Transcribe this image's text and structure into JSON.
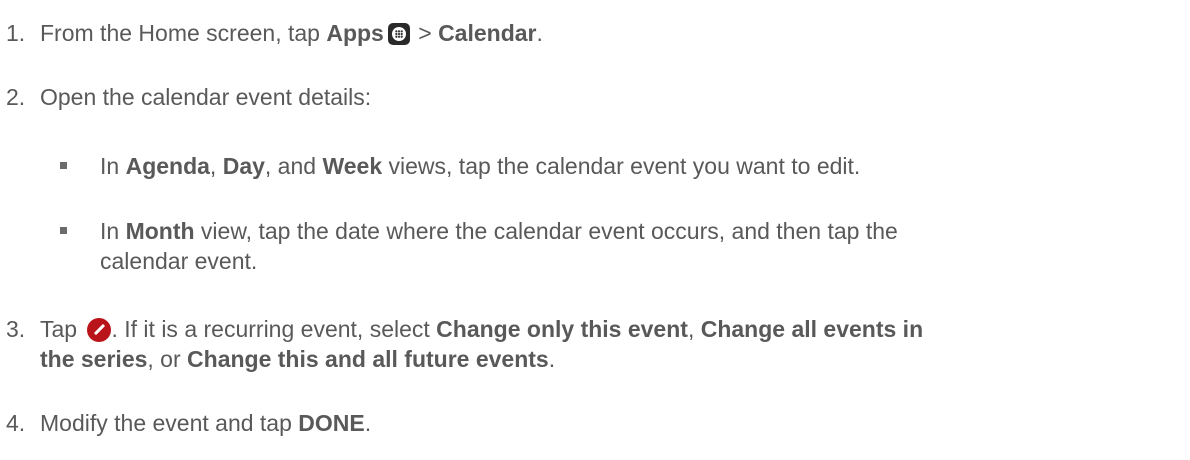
{
  "steps": [
    {
      "num": "1.",
      "t1": "From the Home screen, tap ",
      "b1": "Apps",
      "t2": " > ",
      "b2": "Calendar",
      "t3": "."
    },
    {
      "num": "2.",
      "t1": "Open the calendar event details:",
      "subs": [
        {
          "t1": "In ",
          "b1": "Agenda",
          "t2": ", ",
          "b2": "Day",
          "t3": ", and ",
          "b3": "Week",
          "t4": " views, tap the calendar event you want to edit."
        },
        {
          "t1": "In ",
          "b1": "Month",
          "t2": " view, tap the date where the calendar event occurs, and then tap the",
          "line2": "calendar event."
        }
      ]
    },
    {
      "num": "3.",
      "t1": "Tap ",
      "t2": ". If it is a recurring event, select ",
      "b1": "Change only this event",
      "t3": ", ",
      "b2": "Change all events in",
      "b2b": "the series",
      "t4": ", or ",
      "b3": "Change this and all future events",
      "t5": "."
    },
    {
      "num": "4.",
      "t1": "Modify the event and tap ",
      "b1": "DONE",
      "t2": "."
    }
  ],
  "icons": {
    "apps": "apps-grid-icon",
    "edit": "pencil-edit-icon",
    "edit_color": "#b8141a"
  }
}
